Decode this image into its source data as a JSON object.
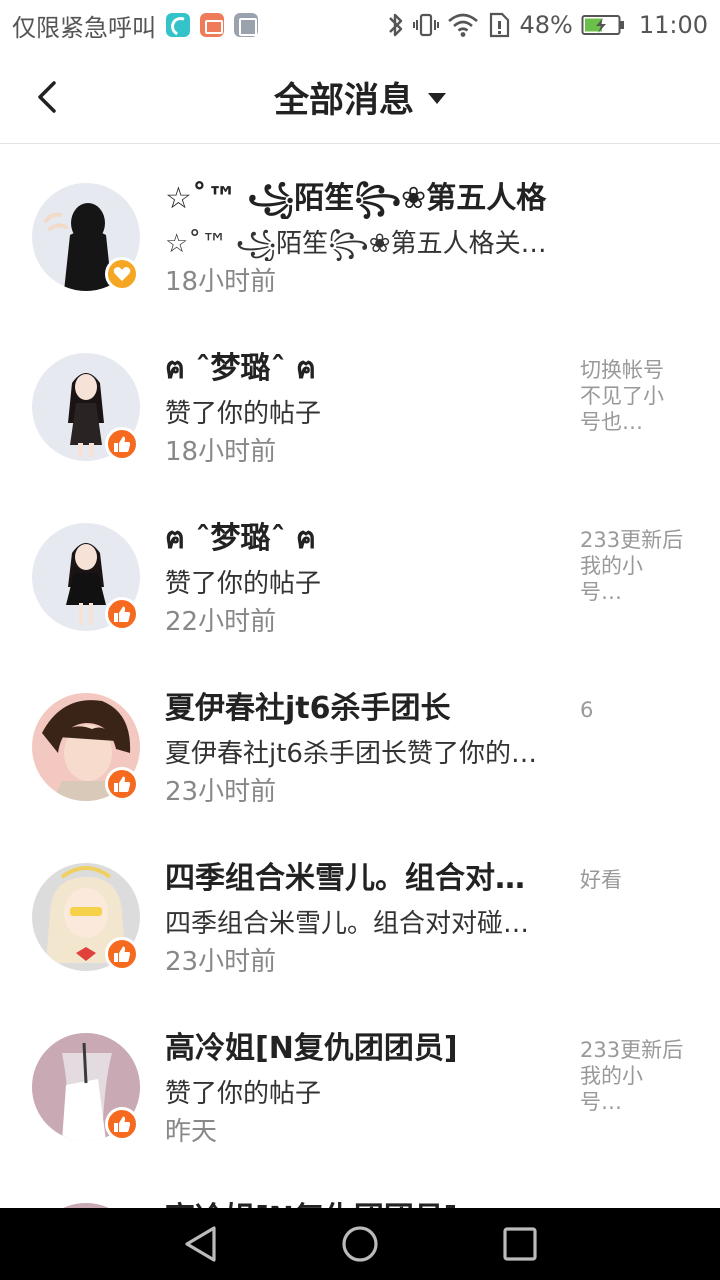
{
  "status_bar": {
    "carrier": "仅限紧急呼叫",
    "battery": "48%",
    "time": "11:00"
  },
  "header": {
    "title": "全部消息"
  },
  "messages": [
    {
      "name": "☆˚™ ꧁陌笙꧂❀第五人格",
      "action": "☆˚™ ꧁陌笙꧂❀第五人格关注了你",
      "time": "18小时前",
      "preview": "",
      "badge": "heart-icon"
    },
    {
      "name": "ฅ ˆ梦璐ˆ ฅ",
      "action": "赞了你的帖子",
      "time": "18小时前",
      "preview": "切换帐号不见了小号也…",
      "badge": "thumbs-up-icon"
    },
    {
      "name": "ฅ ˆ梦璐ˆ ฅ",
      "action": "赞了你的帖子",
      "time": "22小时前",
      "preview": "233更新后我的小号…",
      "badge": "thumbs-up-icon"
    },
    {
      "name": "夏伊春社jt6杀手团长",
      "action": "夏伊春社jt6杀手团长赞了你的…",
      "time": "23小时前",
      "preview": "6",
      "badge": "thumbs-up-icon"
    },
    {
      "name": "四季组合米雪儿。组合对…",
      "action": "四季组合米雪儿。组合对对碰…",
      "time": "23小时前",
      "preview": "好看",
      "badge": "thumbs-up-icon"
    },
    {
      "name": "高冷姐[N复仇团团员]",
      "action": "赞了你的帖子",
      "time": "昨天",
      "preview": "233更新后我的小号…",
      "badge": "thumbs-up-icon"
    },
    {
      "name": "高冷姐[N复仇团团员]",
      "action": "",
      "time": "",
      "preview": "",
      "badge": "thumbs-up-icon"
    }
  ],
  "colors": {
    "like_badge": "#f56a1e",
    "follow_badge": "#f5a623",
    "muted_text": "#888888"
  }
}
